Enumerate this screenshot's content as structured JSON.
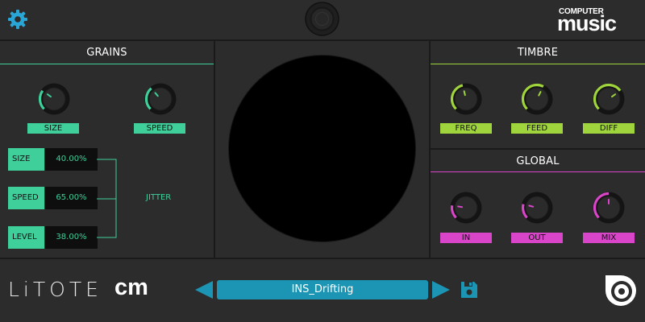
{
  "app": {
    "brand": "COMPUTER MUSIC",
    "brand_line1": "COMPUTER",
    "brand_line2": "music",
    "plugin_name": "LiTOTE",
    "plugin_suffix": "cm"
  },
  "colors": {
    "grains_accent": "#3fcf9a",
    "timbre_accent": "#9fd43c",
    "global_accent": "#d945c8",
    "preset_bar": "#1b95b3",
    "settings_icon": "#2aa6d6"
  },
  "header": {
    "settings_icon": "gear-icon",
    "center_icon": "circle-button-icon"
  },
  "grains": {
    "title": "GRAINS",
    "knobs": [
      {
        "label": "SIZE",
        "level": 0.3
      },
      {
        "label": "SPEED",
        "level": 0.35
      }
    ],
    "jitter": {
      "label": "JITTER",
      "rows": [
        {
          "label": "SIZE",
          "value": "40.00%"
        },
        {
          "label": "SPEED",
          "value": "65.00%"
        },
        {
          "label": "LEVEL",
          "value": "38.00%"
        }
      ]
    }
  },
  "timbre": {
    "title": "TIMBRE",
    "knobs": [
      {
        "label": "FREQ",
        "level": 0.45
      },
      {
        "label": "FEED",
        "level": 0.6
      },
      {
        "label": "DIFF",
        "level": 0.7
      }
    ]
  },
  "global": {
    "title": "GLOBAL",
    "knobs": [
      {
        "label": "IN",
        "level": 0.2
      },
      {
        "label": "OUT",
        "level": 0.22
      },
      {
        "label": "MIX",
        "level": 0.5
      }
    ]
  },
  "preset": {
    "name": "INS_Drifting",
    "prev_icon": "arrow-left-icon",
    "next_icon": "arrow-right-icon",
    "save_icon": "floppy-disk-icon"
  },
  "footer": {
    "logo_icon": "vinyl-logo-icon"
  }
}
